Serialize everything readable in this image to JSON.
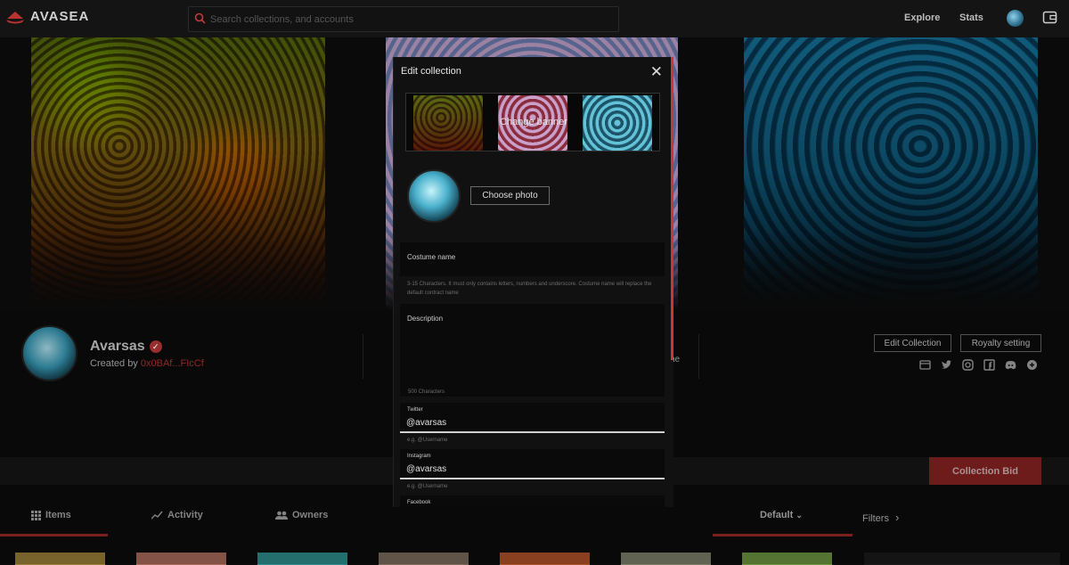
{
  "header": {
    "brand": "AVASEA",
    "search_placeholder": "Search collections, and accounts",
    "nav": [
      "Explore",
      "Stats"
    ]
  },
  "profile": {
    "name": "Avarsas",
    "created_by_label": "Created by",
    "creator_address": "0x0BAf...FIcCf",
    "edit_collection": "Edit Collection",
    "royalty_setting": "Royalty setting",
    "stat_fragment": "ne"
  },
  "bid": {
    "collection_bid": "Collection Bid"
  },
  "tabs": {
    "items": "Items",
    "activity": "Activity",
    "owners": "Owners",
    "sort": "Default",
    "filters": "Filters"
  },
  "modal": {
    "title": "Edit collection",
    "change_banner": "Change banner",
    "choose_photo": "Choose photo",
    "costume_name_label": "Costume name",
    "costume_name_hint": "3-15 Characters. It must only contains letters, numbers and underscore. Costume name will replace the default contract name",
    "description_label": "Description",
    "description_hint": "500 Characters",
    "twitter_label": "Twitter",
    "twitter_value": "@avarsas",
    "twitter_hint": "e.g. @Username",
    "instagram_label": "Instagram",
    "instagram_value": "@avarsas",
    "instagram_hint": "e.g. @Username",
    "facebook_label": "Facebook"
  },
  "colors": {
    "accent": "#c33a3a",
    "bid_button": "#8d2323",
    "background": "#0c0c0c"
  }
}
